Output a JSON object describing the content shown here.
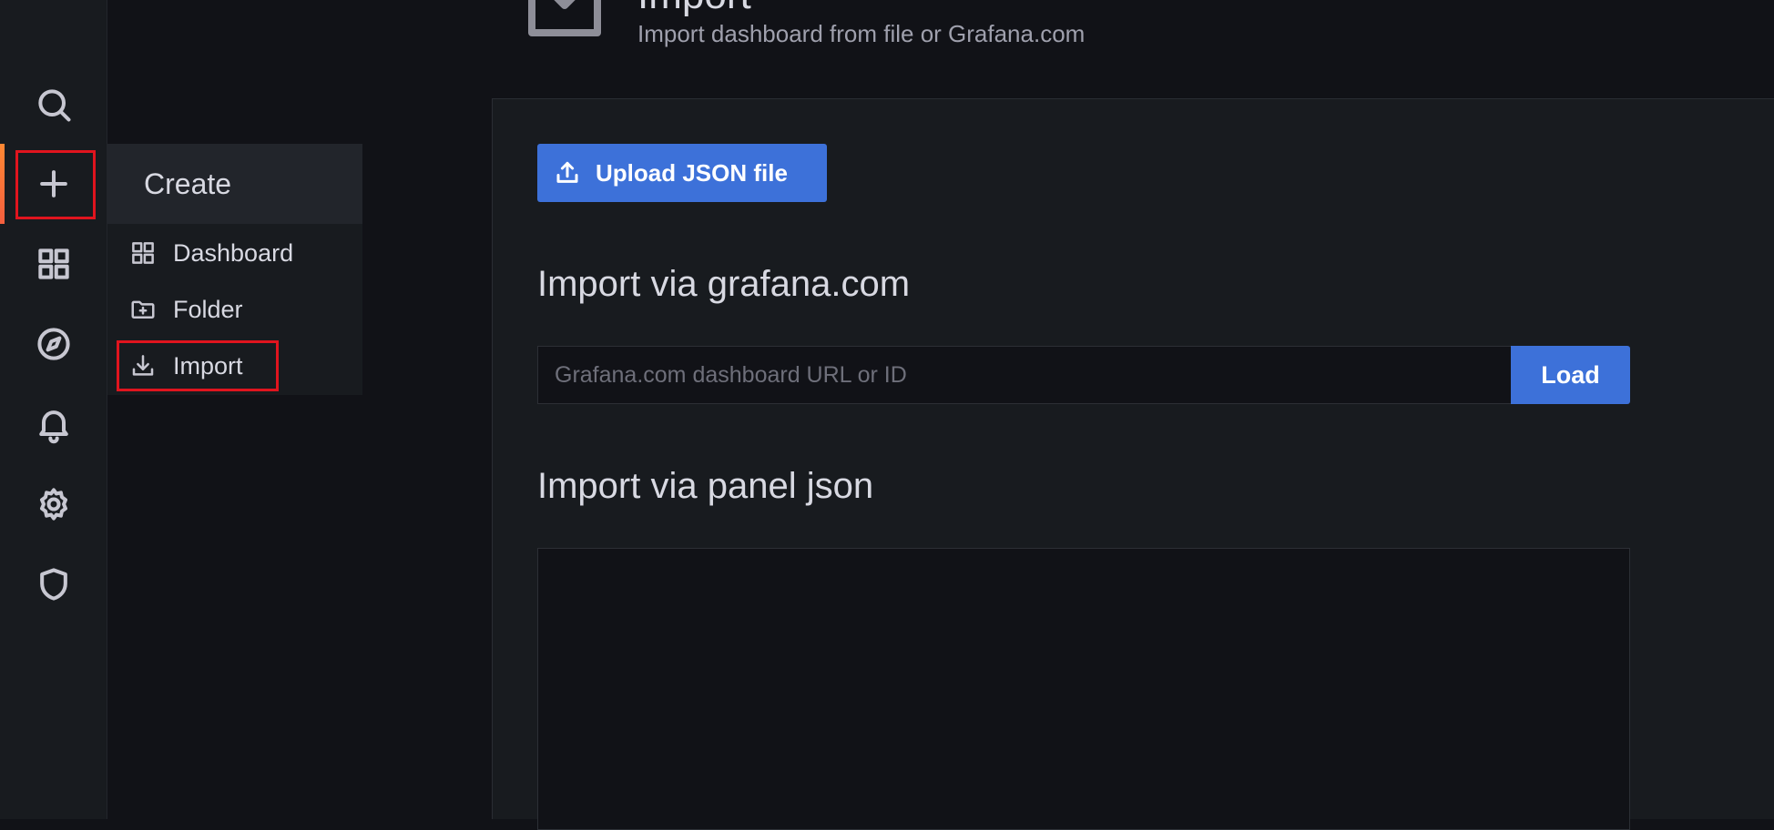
{
  "sidebar": {
    "items": [
      {
        "icon": "search-icon"
      },
      {
        "icon": "plus-icon",
        "active": true
      },
      {
        "icon": "dashboards-icon"
      },
      {
        "icon": "compass-icon"
      },
      {
        "icon": "bell-icon"
      },
      {
        "icon": "gear-icon"
      },
      {
        "icon": "shield-icon"
      }
    ]
  },
  "create_menu": {
    "title": "Create",
    "items": [
      {
        "label": "Dashboard",
        "icon": "dashboard-icon"
      },
      {
        "label": "Folder",
        "icon": "folder-plus-icon"
      },
      {
        "label": "Import",
        "icon": "import-icon"
      }
    ]
  },
  "page": {
    "title": "Import",
    "subtitle": "Import dashboard from file or Grafana.com"
  },
  "main": {
    "upload_label": "Upload JSON file",
    "grafana_section_title": "Import via grafana.com",
    "grafana_input_placeholder": "Grafana.com dashboard URL or ID",
    "load_label": "Load",
    "panel_json_section_title": "Import via panel json"
  },
  "colors": {
    "accent_blue": "#3d71d9",
    "highlight_red": "#e0141e",
    "active_orange": "#ff8833"
  }
}
